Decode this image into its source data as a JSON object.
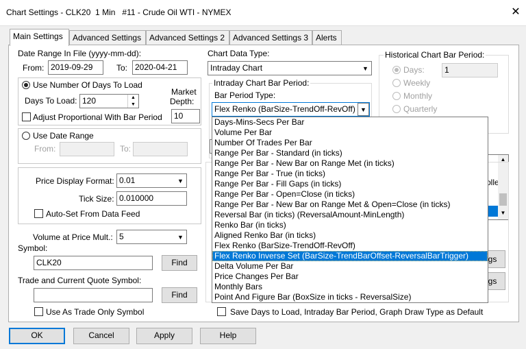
{
  "window": {
    "title": "Chart Settings - CLK20  1 Min   #11 - Crude Oil WTI - NYMEX",
    "close_glyph": "✕"
  },
  "tabs": [
    "Main Settings",
    "Advanced Settings",
    "Advanced Settings 2",
    "Advanced Settings 3",
    "Alerts"
  ],
  "date_range": {
    "label": "Date Range In File (yyyy-mm-dd):",
    "from_label": "From:",
    "from_value": "2019-09-29",
    "to_label": "To:",
    "to_value": "2020-04-21"
  },
  "days_group": {
    "use_days_label": "Use Number Of Days To Load",
    "days_to_load_label": "Days To Load:",
    "days_to_load_value": "120",
    "market_depth_label": "Market",
    "market_depth_label2": "Depth:",
    "market_depth_value": "10",
    "adjust_label": "Adjust Proportional With Bar Period"
  },
  "date_range_group": {
    "use_label": "Use Date Range",
    "from_label": "From:",
    "to_label": "To:"
  },
  "price_group": {
    "format_label": "Price Display Format:",
    "format_value": "0.01",
    "tick_label": "Tick Size:",
    "tick_value": "0.010000",
    "auto_set_label": "Auto-Set From Data Feed"
  },
  "volume": {
    "label": "Volume at Price Mult.:",
    "value": "5"
  },
  "symbol": {
    "label": "Symbol:",
    "value": "CLK20",
    "find_label": "Find"
  },
  "trade_symbol": {
    "label": "Trade and Current Quote Symbol:",
    "value": "",
    "find_label": "Find",
    "trade_only_label": "Use As Trade Only Symbol"
  },
  "chart_data_type": {
    "label": "Chart Data Type:",
    "value": "Intraday Chart"
  },
  "intraday_bar": {
    "group_label": "Intraday Chart Bar Period:",
    "bar_period_type_label": "Bar Period Type:",
    "bar_period_type_value": "Flex Renko (BarSize-TrendOff-RevOff)"
  },
  "historical": {
    "group_label": "Historical Chart Bar Period:",
    "options": [
      "Days:",
      "Weekly",
      "Monthly",
      "Quarterly"
    ],
    "days_value": "1"
  },
  "right_partial": {
    "label_fragment": "olle",
    "btn1_fragment": "gs",
    "btn2_fragment": "gs"
  },
  "dropdown_items": [
    "Days-Mins-Secs Per Bar",
    "Volume Per Bar",
    "Number Of Trades Per Bar",
    "Range Per Bar - Standard (in ticks)",
    "Range Per Bar - New Bar on Range Met (in ticks)",
    "Range Per Bar - True (in ticks)",
    "Range Per Bar - Fill Gaps (in ticks)",
    "Range Per Bar - Open=Close (in ticks)",
    "Range Per Bar - New Bar on Range Met & Open=Close (in ticks)",
    "Reversal Bar (in ticks) (ReversalAmount-MinLength)",
    "Renko Bar (in ticks)",
    "Aligned Renko Bar (in ticks)",
    "Flex Renko (BarSize-TrendOff-RevOff)",
    "Flex Renko Inverse Set (BarSize-TrendBarOffset-ReversalBarTrigger)",
    "Delta Volume Per Bar",
    "Price Changes Per Bar",
    "Monthly Bars",
    "Point And Figure Bar (BoxSize in ticks - ReversalSize)"
  ],
  "save_default_label": "Save Days to Load, Intraday Bar Period, Graph Draw Type as Default",
  "buttons": {
    "ok": "OK",
    "cancel": "Cancel",
    "apply": "Apply",
    "help": "Help"
  }
}
